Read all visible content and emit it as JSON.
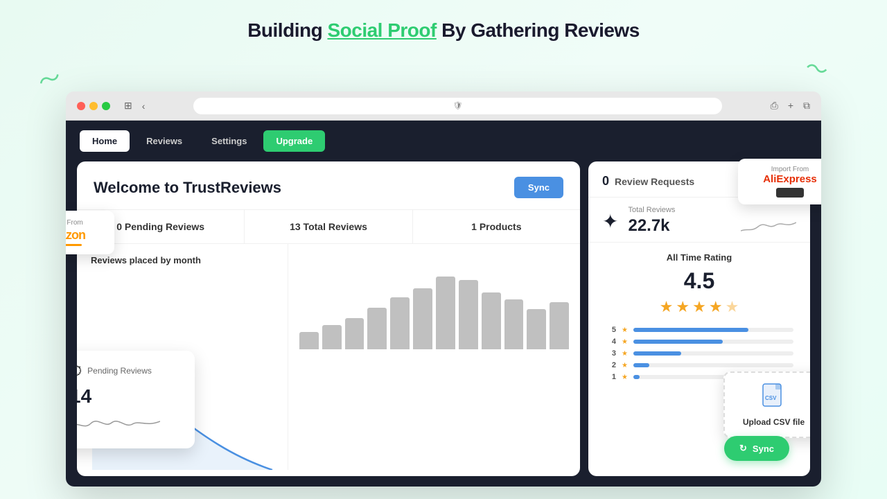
{
  "page": {
    "title_prefix": "Building ",
    "title_highlight": "Social Proof",
    "title_suffix": " By Gathering Reviews"
  },
  "nav": {
    "home": "Home",
    "reviews": "Reviews",
    "settings": "Settings",
    "upgrade": "Upgrade"
  },
  "welcome": {
    "title": "Welcome to TrustReviews",
    "sync_label": "Sync",
    "stats": [
      {
        "label": "0 Pending Reviews"
      },
      {
        "label": "13 Total Reviews"
      },
      {
        "label": "1 Products"
      }
    ],
    "chart_title": "Reviews placed by month"
  },
  "right_panel": {
    "review_requests_count": "0",
    "review_requests_label": "Review Requests",
    "star_icon": "✦",
    "total_reviews_label": "Total Reviews",
    "total_reviews_number": "22.7k",
    "all_time_label": "All Time Rating",
    "rating": "4.5",
    "stars": [
      "★",
      "★",
      "★",
      "★",
      "⯨"
    ],
    "rating_bars": [
      {
        "level": "5",
        "width": "72%"
      },
      {
        "level": "4",
        "width": "58%"
      },
      {
        "level": "3",
        "width": "32%"
      },
      {
        "level": "2",
        "width": "10%"
      },
      {
        "level": "1",
        "width": "5%"
      }
    ]
  },
  "import_amazon": {
    "from_label": "Import From",
    "logo": "amazon"
  },
  "import_aliexpress": {
    "from_label": "Import From",
    "logo": "AliExpress"
  },
  "pending_card": {
    "label": "Pending Reviews",
    "number": "14"
  },
  "csv": {
    "label": "Upload CSV file"
  },
  "sync_bottom": {
    "label": "Sync"
  },
  "bars": [
    30,
    45,
    55,
    70,
    85,
    95,
    110,
    105,
    90,
    80,
    65,
    75
  ]
}
